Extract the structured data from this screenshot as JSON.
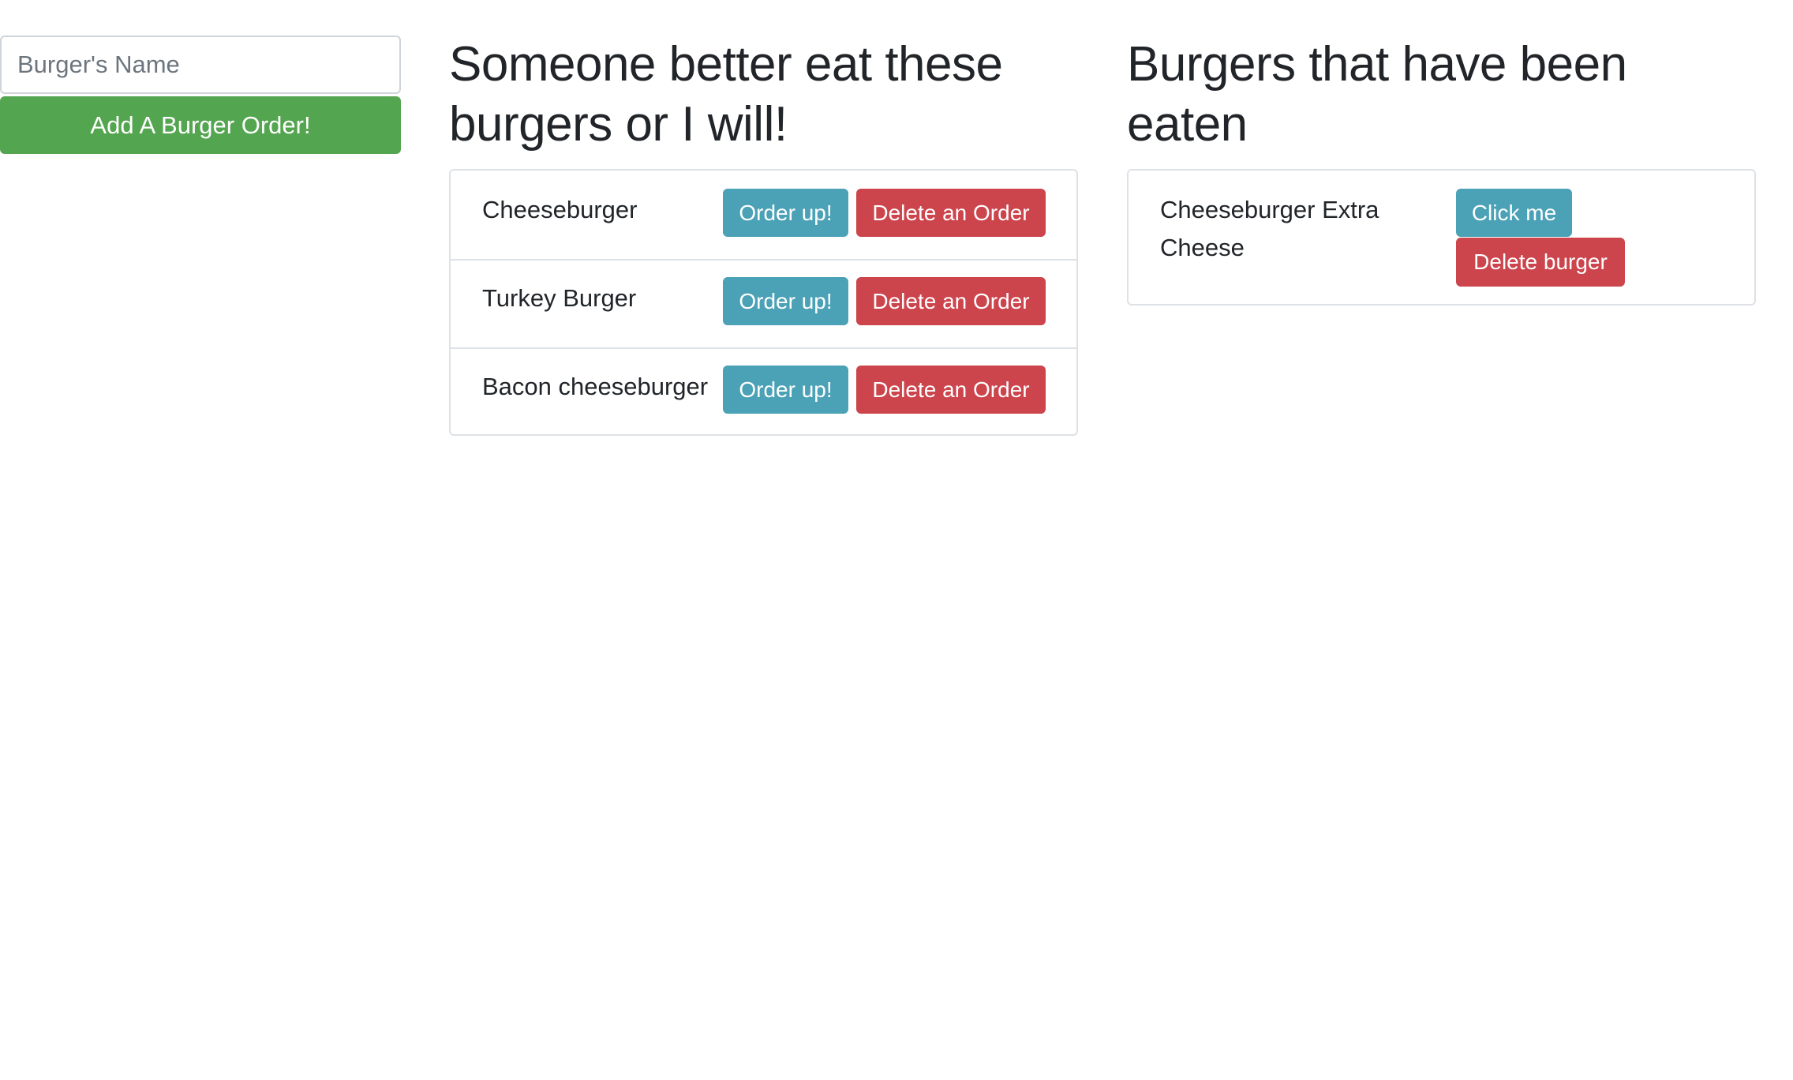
{
  "form": {
    "name_placeholder": "Burger's Name",
    "name_value": "",
    "submit_label": "Add A Burger Order!"
  },
  "uneaten": {
    "heading": "Someone better eat these burgers or I will!",
    "items": [
      {
        "name": "Cheeseburger",
        "order_label": "Order up!",
        "delete_label": "Delete an Order"
      },
      {
        "name": "Turkey Burger",
        "order_label": "Order up!",
        "delete_label": "Delete an Order"
      },
      {
        "name": "Bacon cheeseburger",
        "order_label": "Order up!",
        "delete_label": "Delete an Order"
      }
    ]
  },
  "eaten": {
    "heading": "Burgers that have been eaten",
    "items": [
      {
        "name": "Cheeseburger Extra Cheese",
        "click_label": "Click me",
        "delete_label": "Delete burger"
      }
    ]
  },
  "colors": {
    "success": "#54a550",
    "info": "#4ba1b6",
    "danger": "#cc444c"
  }
}
